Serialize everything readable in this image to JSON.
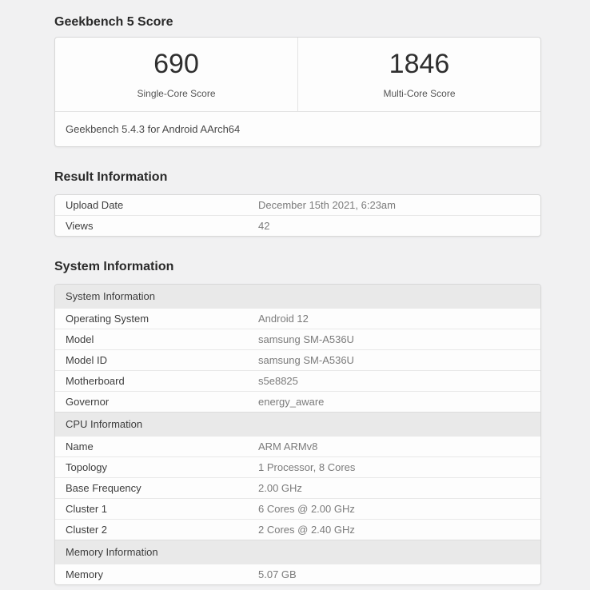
{
  "colors": {
    "page_background": "#f1f1f2",
    "card_background": "#fdfdfd",
    "group_header_background": "#e9e9e9",
    "score_text": "#2f2f2f"
  },
  "benchmark": {
    "title": "Geekbench 5 Score",
    "scores": [
      {
        "value": "690",
        "label": "Single-Core Score"
      },
      {
        "value": "1846",
        "label": "Multi-Core Score"
      }
    ],
    "platform_note": "Geekbench 5.4.3 for Android AArch64"
  },
  "result_information": {
    "title": "Result Information",
    "rows": [
      {
        "label": "Upload Date",
        "value": "December 15th 2021, 6:23am"
      },
      {
        "label": "Views",
        "value": "42"
      }
    ]
  },
  "system_information": {
    "title": "System Information",
    "groups": [
      {
        "header": "System Information",
        "rows": [
          {
            "label": "Operating System",
            "value": "Android 12"
          },
          {
            "label": "Model",
            "value": "samsung SM-A536U"
          },
          {
            "label": "Model ID",
            "value": "samsung SM-A536U"
          },
          {
            "label": "Motherboard",
            "value": "s5e8825"
          },
          {
            "label": "Governor",
            "value": "energy_aware"
          }
        ]
      },
      {
        "header": "CPU Information",
        "rows": [
          {
            "label": "Name",
            "value": "ARM ARMv8"
          },
          {
            "label": "Topology",
            "value": "1 Processor, 8 Cores"
          },
          {
            "label": "Base Frequency",
            "value": "2.00 GHz"
          },
          {
            "label": "Cluster 1",
            "value": "6 Cores @ 2.00 GHz"
          },
          {
            "label": "Cluster 2",
            "value": "2 Cores @ 2.40 GHz"
          }
        ]
      },
      {
        "header": "Memory Information",
        "rows": [
          {
            "label": "Memory",
            "value": "5.07 GB"
          }
        ]
      }
    ]
  }
}
